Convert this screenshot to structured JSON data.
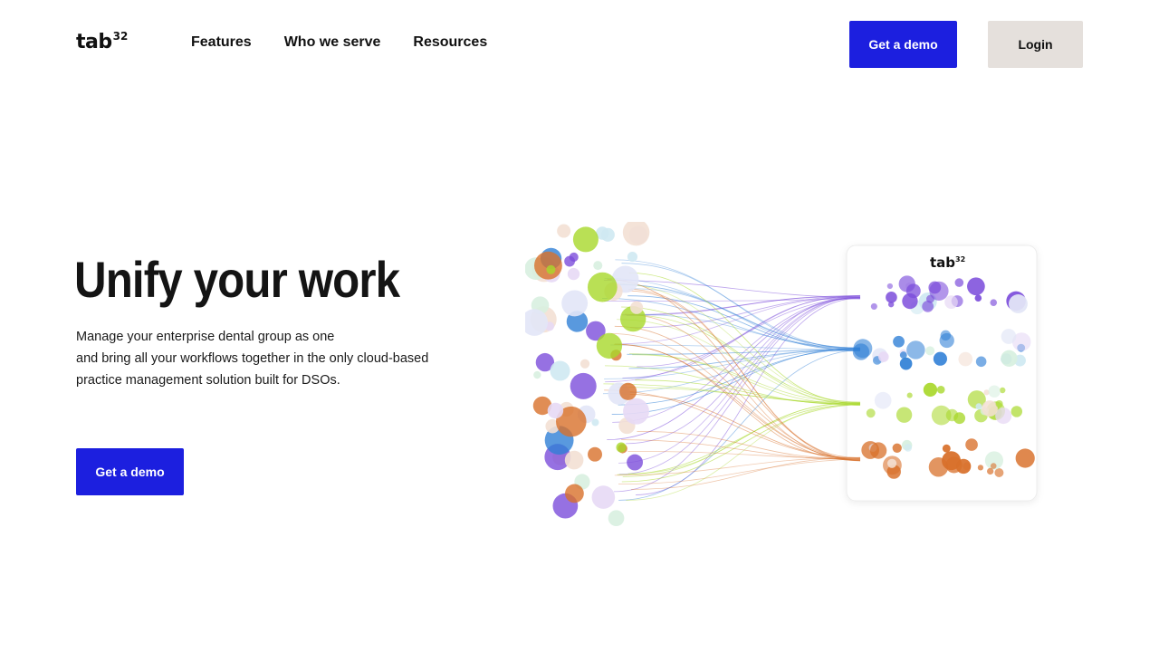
{
  "header": {
    "logo": {
      "text": "tab",
      "superscript": "32"
    },
    "nav": [
      "Features",
      "Who we serve",
      "Resources"
    ],
    "demo_button": "Get a demo",
    "login_button": "Login"
  },
  "hero": {
    "title": "Unify your work",
    "description_lines": [
      "Manage your enterprise dental group as one",
      "and bring all your workflows together in the only cloud-based",
      "practice management solution built for DSOs."
    ],
    "cta_button": "Get a demo"
  },
  "illustration": {
    "card_logo": {
      "text": "tab",
      "superscript": "32"
    }
  },
  "colors": {
    "accent": "#1c1fdf",
    "login_bg": "#e5e0dc",
    "text": "#111111",
    "stream_purple": "#7c4ddb",
    "stream_blue": "#2f7fd6",
    "stream_green": "#a8d82a",
    "stream_orange": "#d8702a"
  }
}
